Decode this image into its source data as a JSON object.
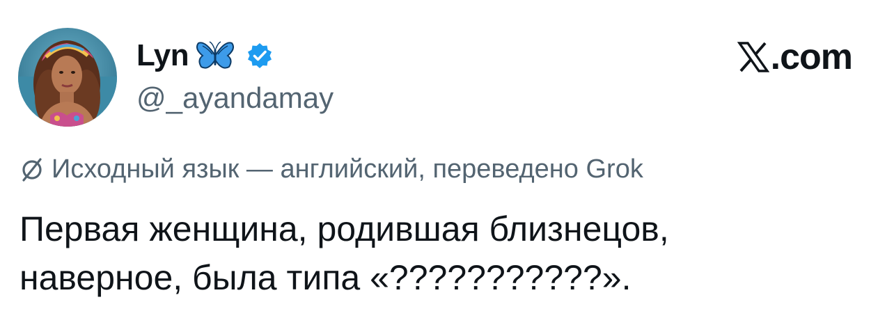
{
  "author": {
    "display_name": "Lyn",
    "handle": "@_ayandamay",
    "avatar_icon": "profile-photo",
    "emoji_icon": "butterfly-icon",
    "verified_icon": "verified-badge-icon",
    "verified_color": "#1d9bf0"
  },
  "site": {
    "logo_icon": "x-logo-icon",
    "label": ".com"
  },
  "translation": {
    "icon": "grok-icon",
    "text": "Исходный язык — английский, переведено Grok"
  },
  "tweet": {
    "lines": [
      "Первая женщина, родившая близнецов,",
      "наверное, была типа «???????????»."
    ]
  },
  "colors": {
    "text_primary": "#0f1419",
    "text_secondary": "#536471",
    "accent": "#1d9bf0"
  }
}
